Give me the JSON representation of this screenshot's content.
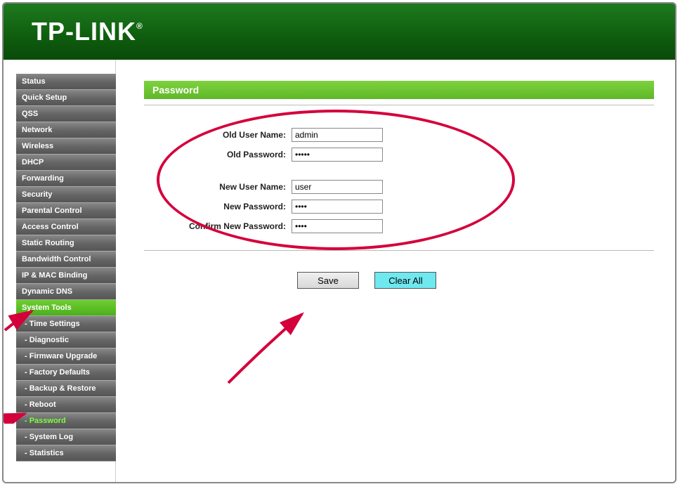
{
  "brand": "TP-LINK",
  "nav": {
    "items": [
      {
        "label": "Status",
        "type": "top"
      },
      {
        "label": "Quick Setup",
        "type": "top"
      },
      {
        "label": "QSS",
        "type": "top"
      },
      {
        "label": "Network",
        "type": "top"
      },
      {
        "label": "Wireless",
        "type": "top"
      },
      {
        "label": "DHCP",
        "type": "top"
      },
      {
        "label": "Forwarding",
        "type": "top"
      },
      {
        "label": "Security",
        "type": "top"
      },
      {
        "label": "Parental Control",
        "type": "top"
      },
      {
        "label": "Access Control",
        "type": "top"
      },
      {
        "label": "Static Routing",
        "type": "top"
      },
      {
        "label": "Bandwidth Control",
        "type": "top"
      },
      {
        "label": "IP & MAC Binding",
        "type": "top"
      },
      {
        "label": "Dynamic DNS",
        "type": "top"
      },
      {
        "label": "System Tools",
        "type": "active-top"
      },
      {
        "label": "- Time Settings",
        "type": "sub"
      },
      {
        "label": "- Diagnostic",
        "type": "sub"
      },
      {
        "label": "- Firmware Upgrade",
        "type": "sub"
      },
      {
        "label": "- Factory Defaults",
        "type": "sub"
      },
      {
        "label": "- Backup & Restore",
        "type": "sub"
      },
      {
        "label": "- Reboot",
        "type": "sub"
      },
      {
        "label": "- Password",
        "type": "sub-active"
      },
      {
        "label": "- System Log",
        "type": "sub"
      },
      {
        "label": "- Statistics",
        "type": "sub"
      }
    ]
  },
  "page": {
    "title": "Password",
    "labels": {
      "old_user": "Old User Name:",
      "old_pass": "Old Password:",
      "new_user": "New User Name:",
      "new_pass": "New Password:",
      "confirm_pass": "Confirm New Password:"
    },
    "values": {
      "old_user": "admin",
      "old_pass": "•••••",
      "new_user": "user",
      "new_pass": "••••",
      "confirm_pass": "••••"
    },
    "buttons": {
      "save": "Save",
      "clear": "Clear All"
    }
  }
}
